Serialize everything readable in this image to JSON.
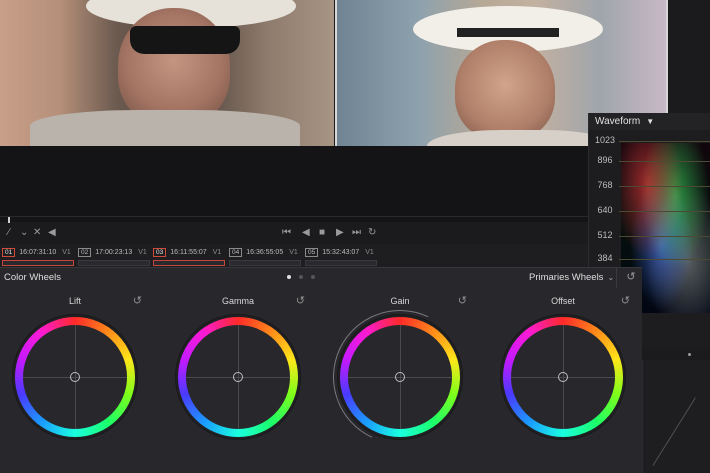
{
  "scope": {
    "title": "Waveform",
    "scale": [
      "1023",
      "896",
      "768",
      "640",
      "512",
      "384"
    ]
  },
  "timeline": {
    "clips": [
      {
        "num": "01",
        "timecode": "16:07:31:10",
        "track": "V1",
        "active": true
      },
      {
        "num": "02",
        "timecode": "17:00:23:13",
        "track": "V1",
        "active": false
      },
      {
        "num": "03",
        "timecode": "16:11:55:07",
        "track": "V1",
        "active": true
      },
      {
        "num": "04",
        "timecode": "16:36:55:05",
        "track": "V1",
        "active": false
      },
      {
        "num": "05",
        "timecode": "15:32:43:07",
        "track": "V1",
        "active": false
      }
    ]
  },
  "panel": {
    "title": "Color Wheels",
    "mode": "Primaries Wheels",
    "page_count": 3,
    "active_page": 1,
    "wheels": [
      {
        "label": "Lift"
      },
      {
        "label": "Gamma"
      },
      {
        "label": "Gain"
      },
      {
        "label": "Offset"
      }
    ]
  },
  "icons": {
    "reset": "reset-icon",
    "chevron": "chevron-down-icon"
  }
}
